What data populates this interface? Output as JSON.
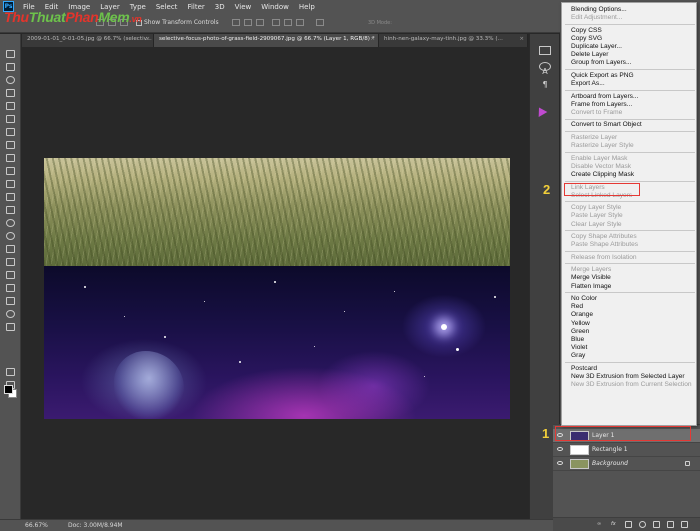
{
  "app": {
    "logo_text": "Ps",
    "menu": [
      "File",
      "Edit",
      "Image",
      "Layer",
      "Type",
      "Select",
      "Filter",
      "3D",
      "View",
      "Window",
      "Help"
    ]
  },
  "watermark": {
    "part1": "Thu",
    "part2": "Thuat",
    "part3": "Phan",
    "part4": "Mem",
    "part5": ".vn"
  },
  "options": {
    "show_transform_label": "Show Transform Controls",
    "mode_3d": "3D Mode:"
  },
  "tabs": [
    {
      "label": "2009-01-01_0-01-05.jpg @ 66.7% (selectiv...",
      "active": false
    },
    {
      "label": "selective-focus-photo-of-grass-field-2909067.jpg @ 66.7% (Layer 1, RGB/8) *",
      "active": true
    },
    {
      "label": "hinh-nen-galaxy-may-tinh.jpg @ 33.3% (...",
      "active": false
    }
  ],
  "status": {
    "zoom": "66.67%",
    "doc": "Doc: 3.00M/8.94M"
  },
  "mini_panel": {
    "icons": [
      "properties-icon",
      "adjust-icon",
      "type-icon",
      "paragraph-icon"
    ]
  },
  "context_menu": {
    "items": [
      {
        "label": "Blending Options...",
        "enabled": true
      },
      {
        "label": "Edit Adjustment...",
        "enabled": false
      },
      {
        "sep": true
      },
      {
        "label": "Copy CSS",
        "enabled": true
      },
      {
        "label": "Copy SVG",
        "enabled": true
      },
      {
        "label": "Duplicate Layer...",
        "enabled": true
      },
      {
        "label": "Delete Layer",
        "enabled": true
      },
      {
        "label": "Group from Layers...",
        "enabled": true
      },
      {
        "sep": true
      },
      {
        "label": "Quick Export as PNG",
        "enabled": true
      },
      {
        "label": "Export As...",
        "enabled": true
      },
      {
        "sep": true
      },
      {
        "label": "Artboard from Layers...",
        "enabled": true
      },
      {
        "label": "Frame from Layers...",
        "enabled": true
      },
      {
        "label": "Convert to Frame",
        "enabled": false
      },
      {
        "sep": true
      },
      {
        "label": "Convert to Smart Object",
        "enabled": true
      },
      {
        "sep": true
      },
      {
        "label": "Rasterize Layer",
        "enabled": false
      },
      {
        "label": "Rasterize Layer Style",
        "enabled": false
      },
      {
        "sep": true
      },
      {
        "label": "Enable Layer Mask",
        "enabled": false
      },
      {
        "label": "Disable Vector Mask",
        "enabled": false
      },
      {
        "label": "Create Clipping Mask",
        "enabled": true
      },
      {
        "sep": true
      },
      {
        "label": "Link Layers",
        "enabled": false
      },
      {
        "label": "Select Linked Layers",
        "enabled": false
      },
      {
        "sep": true
      },
      {
        "label": "Copy Layer Style",
        "enabled": false
      },
      {
        "label": "Paste Layer Style",
        "enabled": false
      },
      {
        "label": "Clear Layer Style",
        "enabled": false
      },
      {
        "sep": true
      },
      {
        "label": "Copy Shape Attributes",
        "enabled": false
      },
      {
        "label": "Paste Shape Attributes",
        "enabled": false
      },
      {
        "sep": true
      },
      {
        "label": "Release from Isolation",
        "enabled": false
      },
      {
        "sep": true
      },
      {
        "label": "Merge Layers",
        "enabled": false
      },
      {
        "label": "Merge Visible",
        "enabled": true
      },
      {
        "label": "Flatten Image",
        "enabled": true
      },
      {
        "sep": true
      },
      {
        "label": "No Color",
        "enabled": true
      },
      {
        "label": "Red",
        "enabled": true
      },
      {
        "label": "Orange",
        "enabled": true
      },
      {
        "label": "Yellow",
        "enabled": true
      },
      {
        "label": "Green",
        "enabled": true
      },
      {
        "label": "Blue",
        "enabled": true
      },
      {
        "label": "Violet",
        "enabled": true
      },
      {
        "label": "Gray",
        "enabled": true
      },
      {
        "sep": true
      },
      {
        "label": "Postcard",
        "enabled": true
      },
      {
        "label": "New 3D Extrusion from Selected Layer",
        "enabled": true
      },
      {
        "label": "New 3D Extrusion from Current Selection",
        "enabled": false
      }
    ]
  },
  "layers": [
    {
      "name": "Layer 1",
      "selected": true,
      "italic": false,
      "thumb": "#3a2d70"
    },
    {
      "name": "Rectangle 1",
      "selected": false,
      "italic": false,
      "thumb": "#ffffff"
    },
    {
      "name": "Background",
      "selected": false,
      "italic": true,
      "thumb": "#8a9460",
      "locked": true
    }
  ],
  "annotations": {
    "step1": "1",
    "step2": "2"
  },
  "colors": {
    "accent_red": "#e53935",
    "step_yellow": "#f2cf3a",
    "foreground": "#000000",
    "background": "#ffffff"
  }
}
